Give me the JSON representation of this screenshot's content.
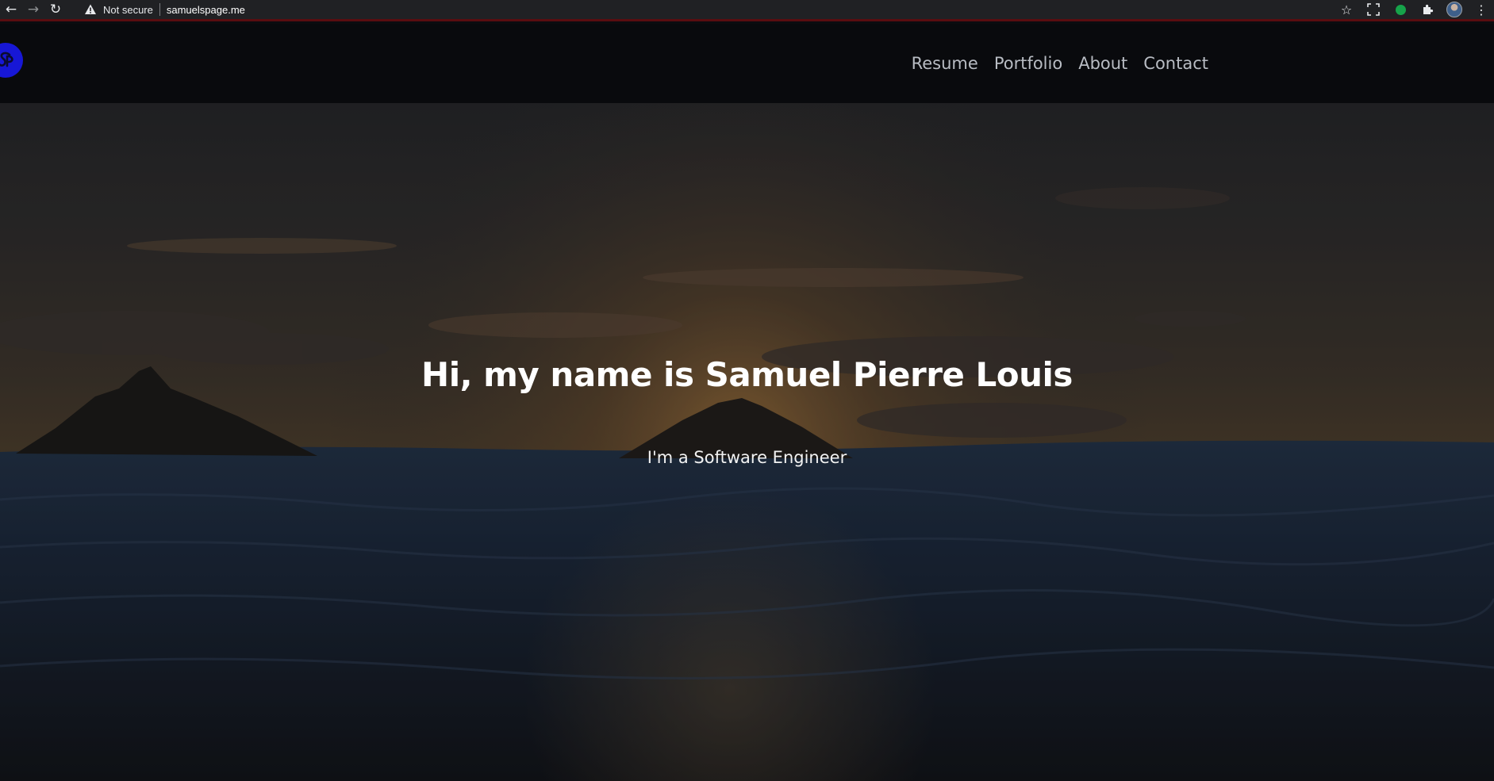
{
  "browser": {
    "back_icon": "arrow-left-icon",
    "forward_icon": "arrow-right-icon",
    "reload_icon": "reload-icon",
    "security_icon": "warning-triangle-icon",
    "security_label": "Not secure",
    "url": "samuelspage.me",
    "bookmark_icon": "star-icon",
    "screenshot_icon": "screen-capture-icon",
    "extension_icon": "green-dot-extension-icon",
    "extensions_icon": "puzzle-icon",
    "profile_icon": "profile-avatar-icon",
    "menu_icon": "kebab-menu-icon"
  },
  "site": {
    "logo_icon": "sp-logo-icon",
    "logo_color": "#1717d6",
    "nav": [
      {
        "label": "Resume"
      },
      {
        "label": "Portfolio"
      },
      {
        "label": "About"
      },
      {
        "label": "Contact"
      }
    ]
  },
  "hero": {
    "title": "Hi, my name is Samuel Pierre Louis",
    "subtitle": "I'm a Software Engineer",
    "background": "sunset-ocean-islands-photo"
  }
}
